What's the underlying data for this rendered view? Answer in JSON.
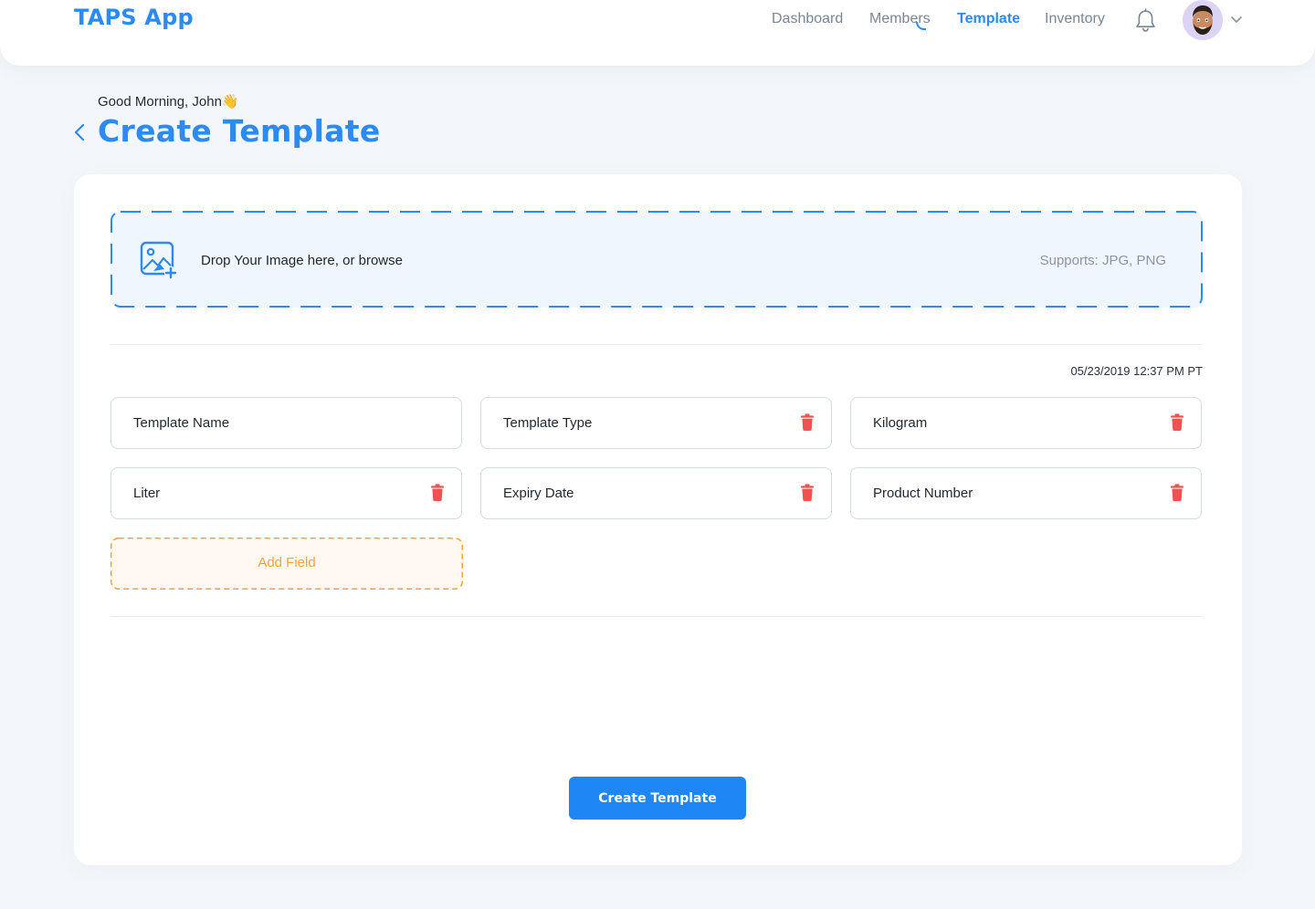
{
  "app": {
    "title": "TAPS App"
  },
  "nav": {
    "items": [
      {
        "label": "Dashboard",
        "active": false
      },
      {
        "label": "Members",
        "active": false
      },
      {
        "label": "Template",
        "active": true
      },
      {
        "label": "Inventory",
        "active": false
      }
    ]
  },
  "header": {
    "icons": {
      "notifications": "bell-icon",
      "user_menu": "chevron-down-icon"
    }
  },
  "page": {
    "greeting": "Good Morning, John👋",
    "title": "Create Template",
    "back_icon": "chevron-left-icon"
  },
  "upload": {
    "icon": "image-add-icon",
    "prompt": "Drop Your Image here, or browse",
    "supports": "Supports: JPG, PNG"
  },
  "form": {
    "timestamp": "05/23/2019 12:37 PM PT",
    "fields": [
      {
        "label": "Template Name",
        "deletable": false
      },
      {
        "label": "Template Type",
        "deletable": true
      },
      {
        "label": "Kilogram",
        "deletable": true
      },
      {
        "label": "Liter",
        "deletable": true
      },
      {
        "label": "Expiry Date",
        "deletable": true
      },
      {
        "label": "Product Number",
        "deletable": true
      }
    ],
    "add_field_label": "Add Field",
    "submit_label": "Create Template"
  },
  "colors": {
    "brand": "#2b8bf2",
    "primary_button": "#1f87f5",
    "delete": "#f05252",
    "add_field": "#f3a33e",
    "page_background": "#f3f7fb"
  }
}
